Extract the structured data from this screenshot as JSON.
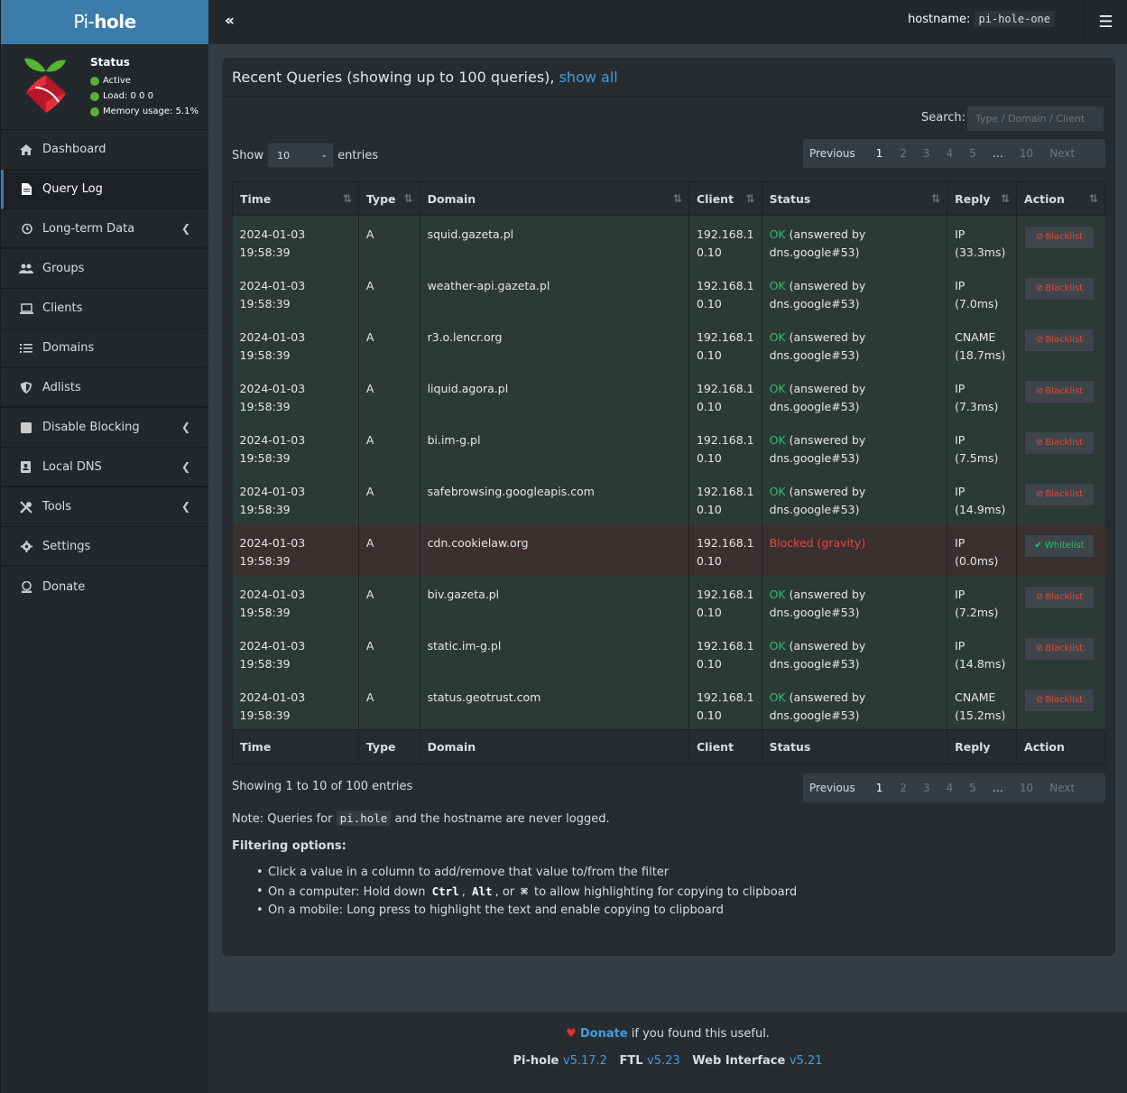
{
  "app": {
    "logo_prefix": "Pi-",
    "logo_suffix": "hole"
  },
  "topbar": {
    "hostname_label": "hostname:",
    "hostname_value": "pi-hole-one"
  },
  "status": {
    "title": "Status",
    "active": "Active",
    "load": "Load:  0  0  0",
    "memory": "Memory usage:  5.1%",
    "dot_color": "#5bb035"
  },
  "menu": [
    {
      "label": "Dashboard",
      "icon": "home-icon"
    },
    {
      "label": "Query Log",
      "icon": "file-icon",
      "active": true
    },
    {
      "label": "Long-term Data",
      "icon": "history-icon",
      "chevron": true
    },
    {
      "label": "Groups",
      "icon": "users-icon"
    },
    {
      "label": "Clients",
      "icon": "laptop-icon"
    },
    {
      "label": "Domains",
      "icon": "list-icon"
    },
    {
      "label": "Adlists",
      "icon": "shield-icon"
    },
    {
      "label": "Disable Blocking",
      "icon": "stop-icon",
      "chevron": true
    },
    {
      "label": "Local DNS",
      "icon": "address-book-icon",
      "chevron": true
    },
    {
      "label": "Tools",
      "icon": "tools-icon",
      "chevron": true
    },
    {
      "label": "Settings",
      "icon": "gear-icon"
    },
    {
      "label": "Donate",
      "icon": "donate-icon"
    }
  ],
  "box": {
    "title": "Recent Queries (showing up to 100 queries),",
    "show_all": "show all",
    "search_label": "Search:",
    "search_placeholder": "Type / Domain / Client",
    "show_label": "Show",
    "length_value": "10",
    "entries_label": "entries",
    "pager": {
      "previous": "Previous",
      "pages": [
        "1",
        "2",
        "3",
        "4",
        "5",
        "…",
        "10"
      ],
      "next": "Next",
      "current": "1"
    },
    "columns": [
      "Time",
      "Type",
      "Domain",
      "Client",
      "Status",
      "Reply",
      "Action"
    ],
    "showing": "Showing 1 to 10 of 100 entries",
    "note_prefix": "Note: Queries for",
    "note_code": "pi.hole",
    "note_suffix": "and the hostname are never logged.",
    "filter_title": "Filtering options:",
    "filter_items": {
      "first": "Click a value in a column to add/remove that value to/from the filter",
      "second_prefix": "On a computer: Hold down",
      "ctrl": "Ctrl",
      "alt": "Alt",
      "or": ", or",
      "cmd": "⌘",
      "second_suffix": "to allow highlighting for copying to clipboard",
      "third": "On a mobile: Long press to highlight the text and enable copying to clipboard"
    }
  },
  "rows": [
    {
      "time": "2024-01-03 19:58:39",
      "type": "A",
      "domain": "squid.gazeta.pl",
      "client1": "192.168.1",
      "client2": "0.10",
      "status_ok": "OK",
      "status_rest": "(answered by dns.google#53)",
      "reply1": "IP",
      "reply2": "(33.3ms)",
      "action": "Blacklist",
      "blocked": false
    },
    {
      "time": "2024-01-03 19:58:39",
      "type": "A",
      "domain": "weather-api.gazeta.pl",
      "client1": "192.168.1",
      "client2": "0.10",
      "status_ok": "OK",
      "status_rest": "(answered by dns.google#53)",
      "reply1": "IP (7.0ms)",
      "reply2": "",
      "action": "Blacklist",
      "blocked": false
    },
    {
      "time": "2024-01-03 19:58:39",
      "type": "A",
      "domain": "r3.o.lencr.org",
      "client1": "192.168.1",
      "client2": "0.10",
      "status_ok": "OK",
      "status_rest": "(answered by dns.google#53)",
      "reply1": "CNAME",
      "reply2": "(18.7ms)",
      "action": "Blacklist",
      "blocked": false
    },
    {
      "time": "2024-01-03 19:58:39",
      "type": "A",
      "domain": "liquid.agora.pl",
      "client1": "192.168.1",
      "client2": "0.10",
      "status_ok": "OK",
      "status_rest": "(answered by dns.google#53)",
      "reply1": "IP (7.3ms)",
      "reply2": "",
      "action": "Blacklist",
      "blocked": false
    },
    {
      "time": "2024-01-03 19:58:39",
      "type": "A",
      "domain": "bi.im-g.pl",
      "client1": "192.168.1",
      "client2": "0.10",
      "status_ok": "OK",
      "status_rest": "(answered by dns.google#53)",
      "reply1": "IP (7.5ms)",
      "reply2": "",
      "action": "Blacklist",
      "blocked": false
    },
    {
      "time": "2024-01-03 19:58:39",
      "type": "A",
      "domain": "safebrowsing.googleapis.com",
      "client1": "192.168.1",
      "client2": "0.10",
      "status_ok": "OK",
      "status_rest": "(answered by dns.google#53)",
      "reply1": "IP",
      "reply2": "(14.9ms)",
      "action": "Blacklist",
      "blocked": false
    },
    {
      "time": "2024-01-03 19:58:39",
      "type": "A",
      "domain": "cdn.cookielaw.org",
      "client1": "192.168.1",
      "client2": "0.10",
      "status_ok": "",
      "status_rest": "Blocked (gravity)",
      "reply1": "IP (0.0ms)",
      "reply2": "",
      "action": "Whitelist",
      "blocked": true
    },
    {
      "time": "2024-01-03 19:58:39",
      "type": "A",
      "domain": "biv.gazeta.pl",
      "client1": "192.168.1",
      "client2": "0.10",
      "status_ok": "OK",
      "status_rest": "(answered by dns.google#53)",
      "reply1": "IP (7.2ms)",
      "reply2": "",
      "action": "Blacklist",
      "blocked": false
    },
    {
      "time": "2024-01-03 19:58:39",
      "type": "A",
      "domain": "static.im-g.pl",
      "client1": "192.168.1",
      "client2": "0.10",
      "status_ok": "OK",
      "status_rest": "(answered by dns.google#53)",
      "reply1": "IP",
      "reply2": "(14.8ms)",
      "action": "Blacklist",
      "blocked": false
    },
    {
      "time": "2024-01-03 19:58:39",
      "type": "A",
      "domain": "status.geotrust.com",
      "client1": "192.168.1",
      "client2": "0.10",
      "status_ok": "OK",
      "status_rest": "(answered by dns.google#53)",
      "reply1": "CNAME",
      "reply2": "(15.2ms)",
      "action": "Blacklist",
      "blocked": false
    }
  ],
  "footer": {
    "donate": "Donate",
    "donate_suffix": "if you found this useful.",
    "pihole_label": "Pi-hole",
    "pihole_ver": "v5.17.2",
    "ftl_label": "FTL",
    "ftl_ver": "v5.23",
    "web_label": "Web Interface",
    "web_ver": "v5.21"
  },
  "colors": {
    "accent": "#3c7cab",
    "ok": "#2bc06a",
    "blocked": "#e04b3c"
  }
}
